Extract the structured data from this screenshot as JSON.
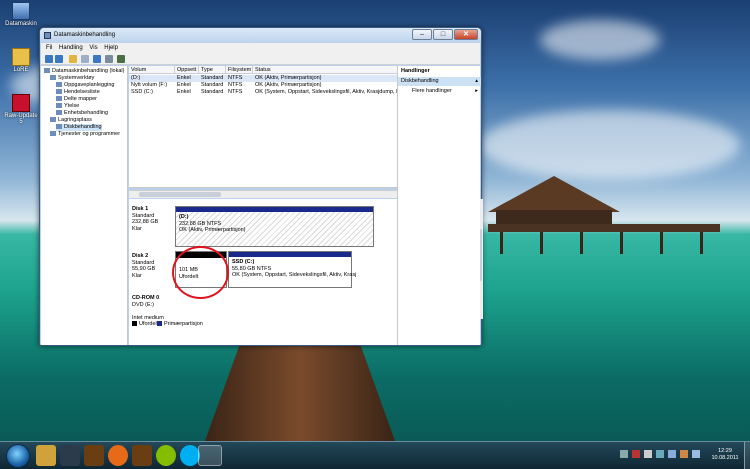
{
  "desktop": {
    "icons": [
      {
        "label": "Datamaskin",
        "icon": "computer-icon"
      },
      {
        "label": "LoRE",
        "icon": "folder-icon"
      },
      {
        "label": "Raw-Update 5",
        "icon": "app-icon"
      }
    ]
  },
  "window": {
    "title": "Datamaskinbehandling",
    "menu": [
      "Fil",
      "Handling",
      "Vis",
      "Hjelp"
    ]
  },
  "tree": [
    {
      "label": "Datamaskinbehandling (lokal)",
      "level": 0
    },
    {
      "label": "Systemverktøy",
      "level": 1
    },
    {
      "label": "Oppgaveplanlegging",
      "level": 2
    },
    {
      "label": "Hendelsesliste",
      "level": 2
    },
    {
      "label": "Delte mapper",
      "level": 2
    },
    {
      "label": "Ytelse",
      "level": 2
    },
    {
      "label": "Enhetsbehandling",
      "level": 2
    },
    {
      "label": "Lagringsplass",
      "level": 1
    },
    {
      "label": "Diskbehandling",
      "level": 2,
      "selected": true
    },
    {
      "label": "Tjenester og programmer",
      "level": 1
    }
  ],
  "volume_list": {
    "columns": [
      "Volum",
      "Oppsett",
      "Type",
      "Filsystem",
      "Status"
    ],
    "rows": [
      {
        "volum": "(D:)",
        "oppsett": "Enkel",
        "type": "Standard",
        "fs": "NTFS",
        "status": "OK (Aktiv, Primærpartisjon)"
      },
      {
        "volum": "Nytt volum (F:)",
        "oppsett": "Enkel",
        "type": "Standard",
        "fs": "NTFS",
        "status": "OK (Aktiv, Primærpartisjon)"
      },
      {
        "volum": "SSD (C:)",
        "oppsett": "Enkel",
        "type": "Standard",
        "fs": "NTFS",
        "status": "OK (System, Oppstart, Sidevekslingsfil, Aktiv, Krasjdump, Pr"
      }
    ]
  },
  "disks": [
    {
      "name": "Disk 1",
      "type": "Standard",
      "size": "232,88 GB",
      "state": "Klar",
      "partitions": [
        {
          "name": "(D:)",
          "line1": "232,88 GB NTFS",
          "line2": "OK (Aktiv, Primærpartisjon)"
        }
      ]
    },
    {
      "name": "Disk 2",
      "type": "Standard",
      "size": "55,90 GB",
      "state": "Klar",
      "partitions": [
        {
          "name": "",
          "line1": "101 MB",
          "line2": "Ufordelt"
        },
        {
          "name": "SSD (C:)",
          "line1": "55,80 GB NTFS",
          "line2": "OK (System, Oppstart, Sidevekslingsfil, Aktiv, Krasj"
        }
      ]
    },
    {
      "name": "CD-ROM 0",
      "type": "DVD (E:)",
      "size": "",
      "state": "",
      "media": "Intet medium"
    }
  ],
  "legend": [
    {
      "label": "Ufordelt",
      "color": "#000000"
    },
    {
      "label": "Primærpartisjon",
      "color": "#1a2a8c"
    }
  ],
  "actions": {
    "header": "Handlinger",
    "section": "Diskbehandling",
    "more": "Flere handlinger"
  },
  "taskbar": {
    "apps": [
      "explorer-icon",
      "steam-icon",
      "wow-icon",
      "firefox-icon",
      "wow2-icon",
      "spotify-icon",
      "skype-icon",
      "computer-management-icon"
    ],
    "clock_time": "12:29",
    "clock_date": "10.08.2011"
  },
  "colors": {
    "primary_partition": "#1a2a8c",
    "unallocated": "#000000",
    "annotation_circle": "#e0121e"
  }
}
